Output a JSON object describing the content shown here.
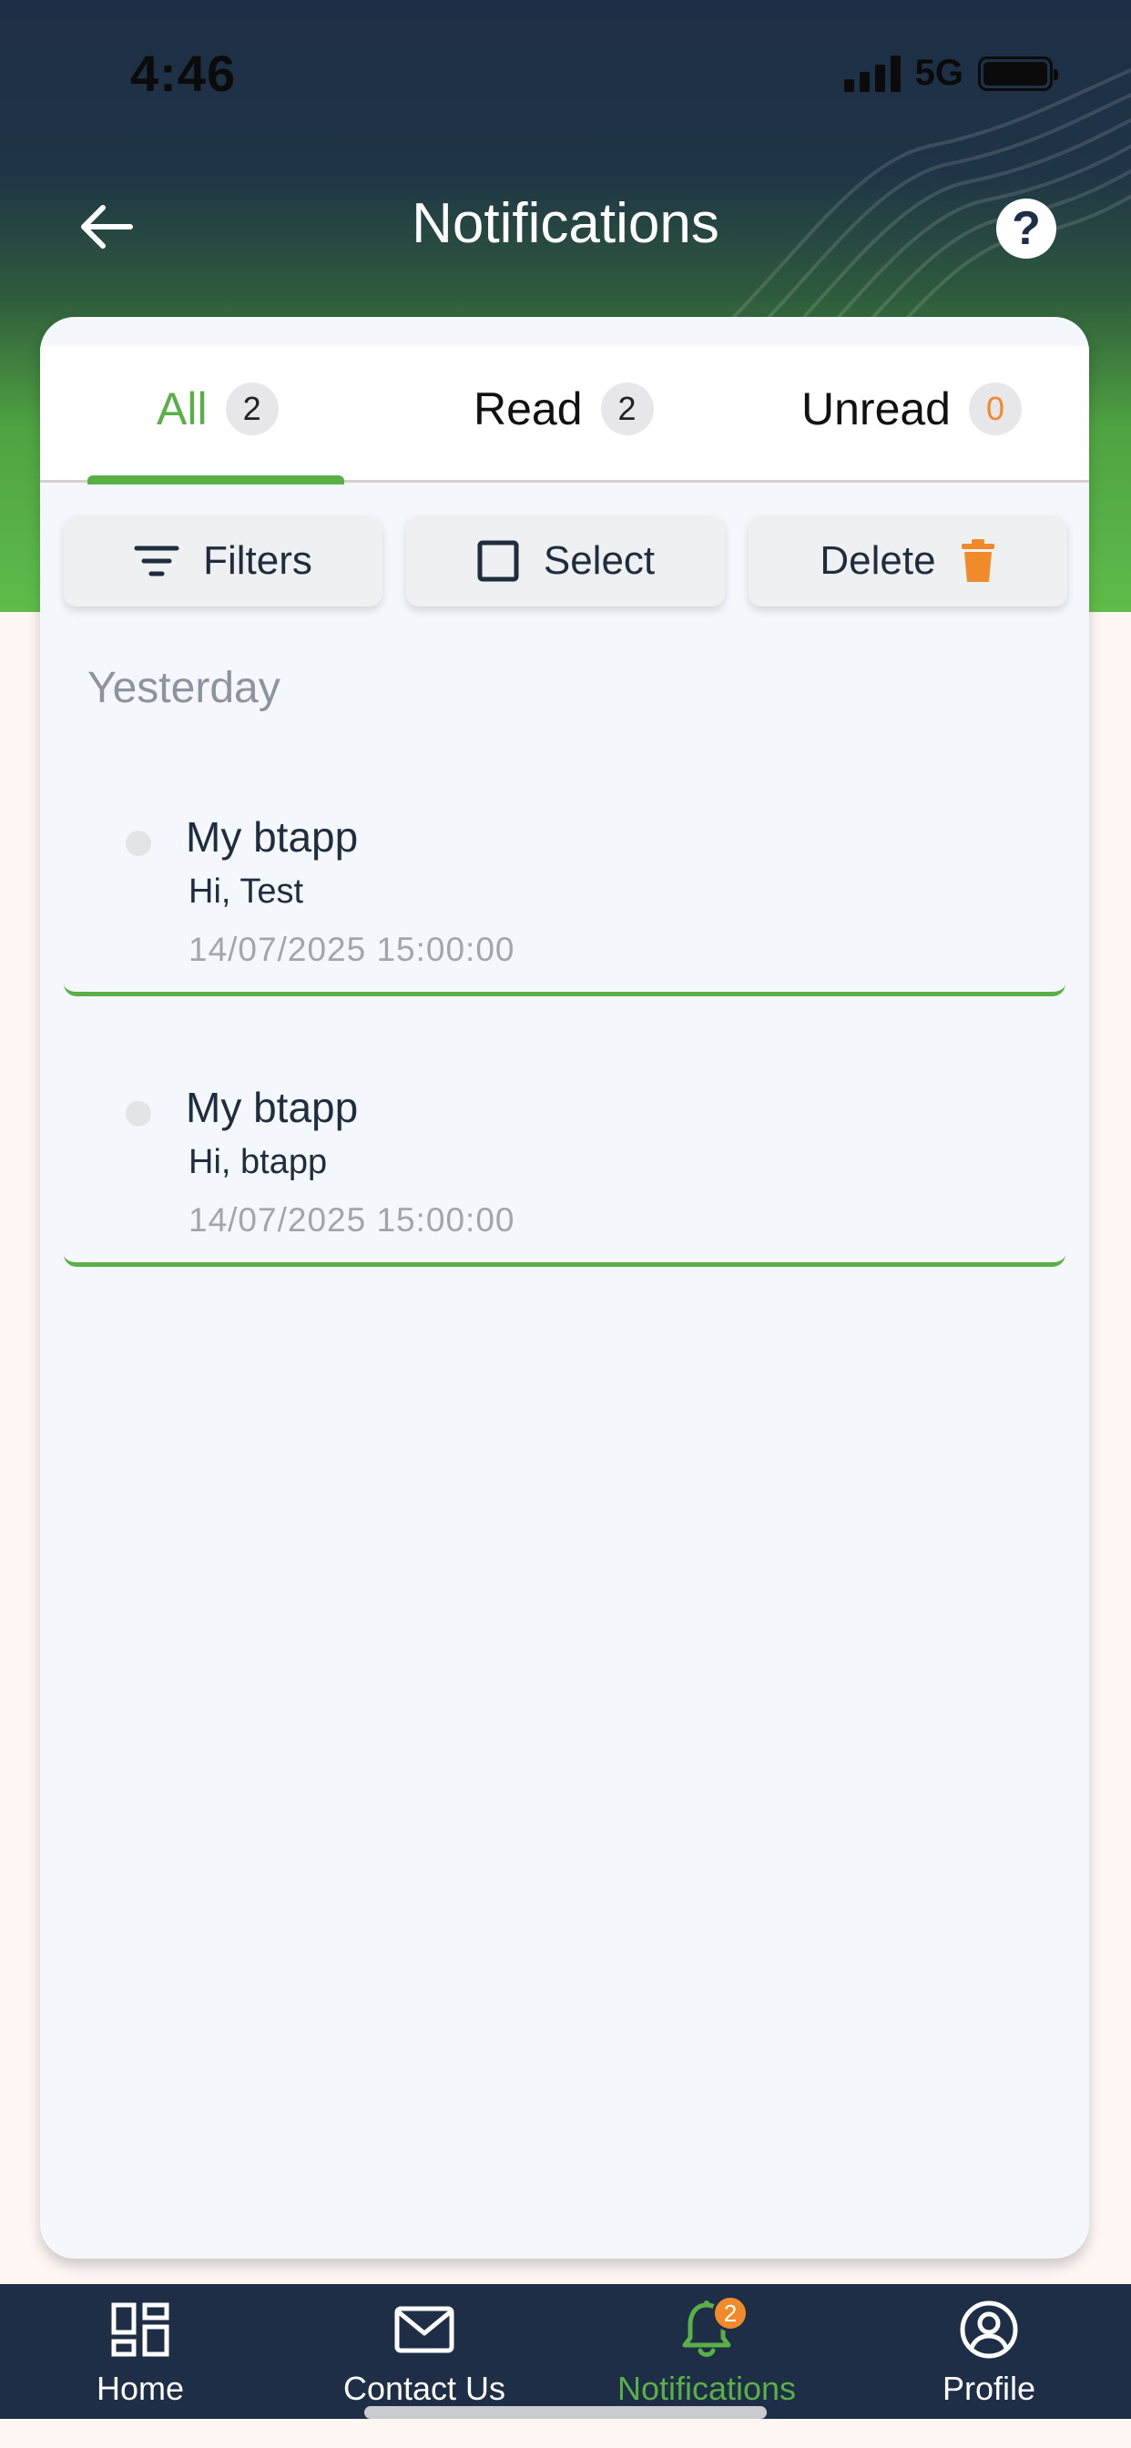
{
  "status": {
    "time": "4:46",
    "network": "5G"
  },
  "header": {
    "title": "Notifications",
    "back_icon": "arrow-left-icon",
    "help_label": "?"
  },
  "tabs": [
    {
      "label": "All",
      "count": "2",
      "active": true
    },
    {
      "label": "Read",
      "count": "2",
      "active": false
    },
    {
      "label": "Unread",
      "count": "0",
      "active": false
    }
  ],
  "actions": {
    "filters": "Filters",
    "select": "Select",
    "delete": "Delete"
  },
  "section": {
    "title": "Yesterday"
  },
  "notifications": [
    {
      "title": "My btapp",
      "body": "Hi, Test",
      "time": "14/07/2025 15:00:00"
    },
    {
      "title": "My btapp",
      "body": "Hi, btapp",
      "time": "14/07/2025 15:00:00"
    }
  ],
  "tabbar": {
    "home": "Home",
    "contact": "Contact Us",
    "notifications": "Notifications",
    "notifications_badge": "2",
    "profile": "Profile"
  },
  "colors": {
    "accent": "#5ab047",
    "navy": "#1e2e46",
    "orange": "#f08a2b"
  }
}
